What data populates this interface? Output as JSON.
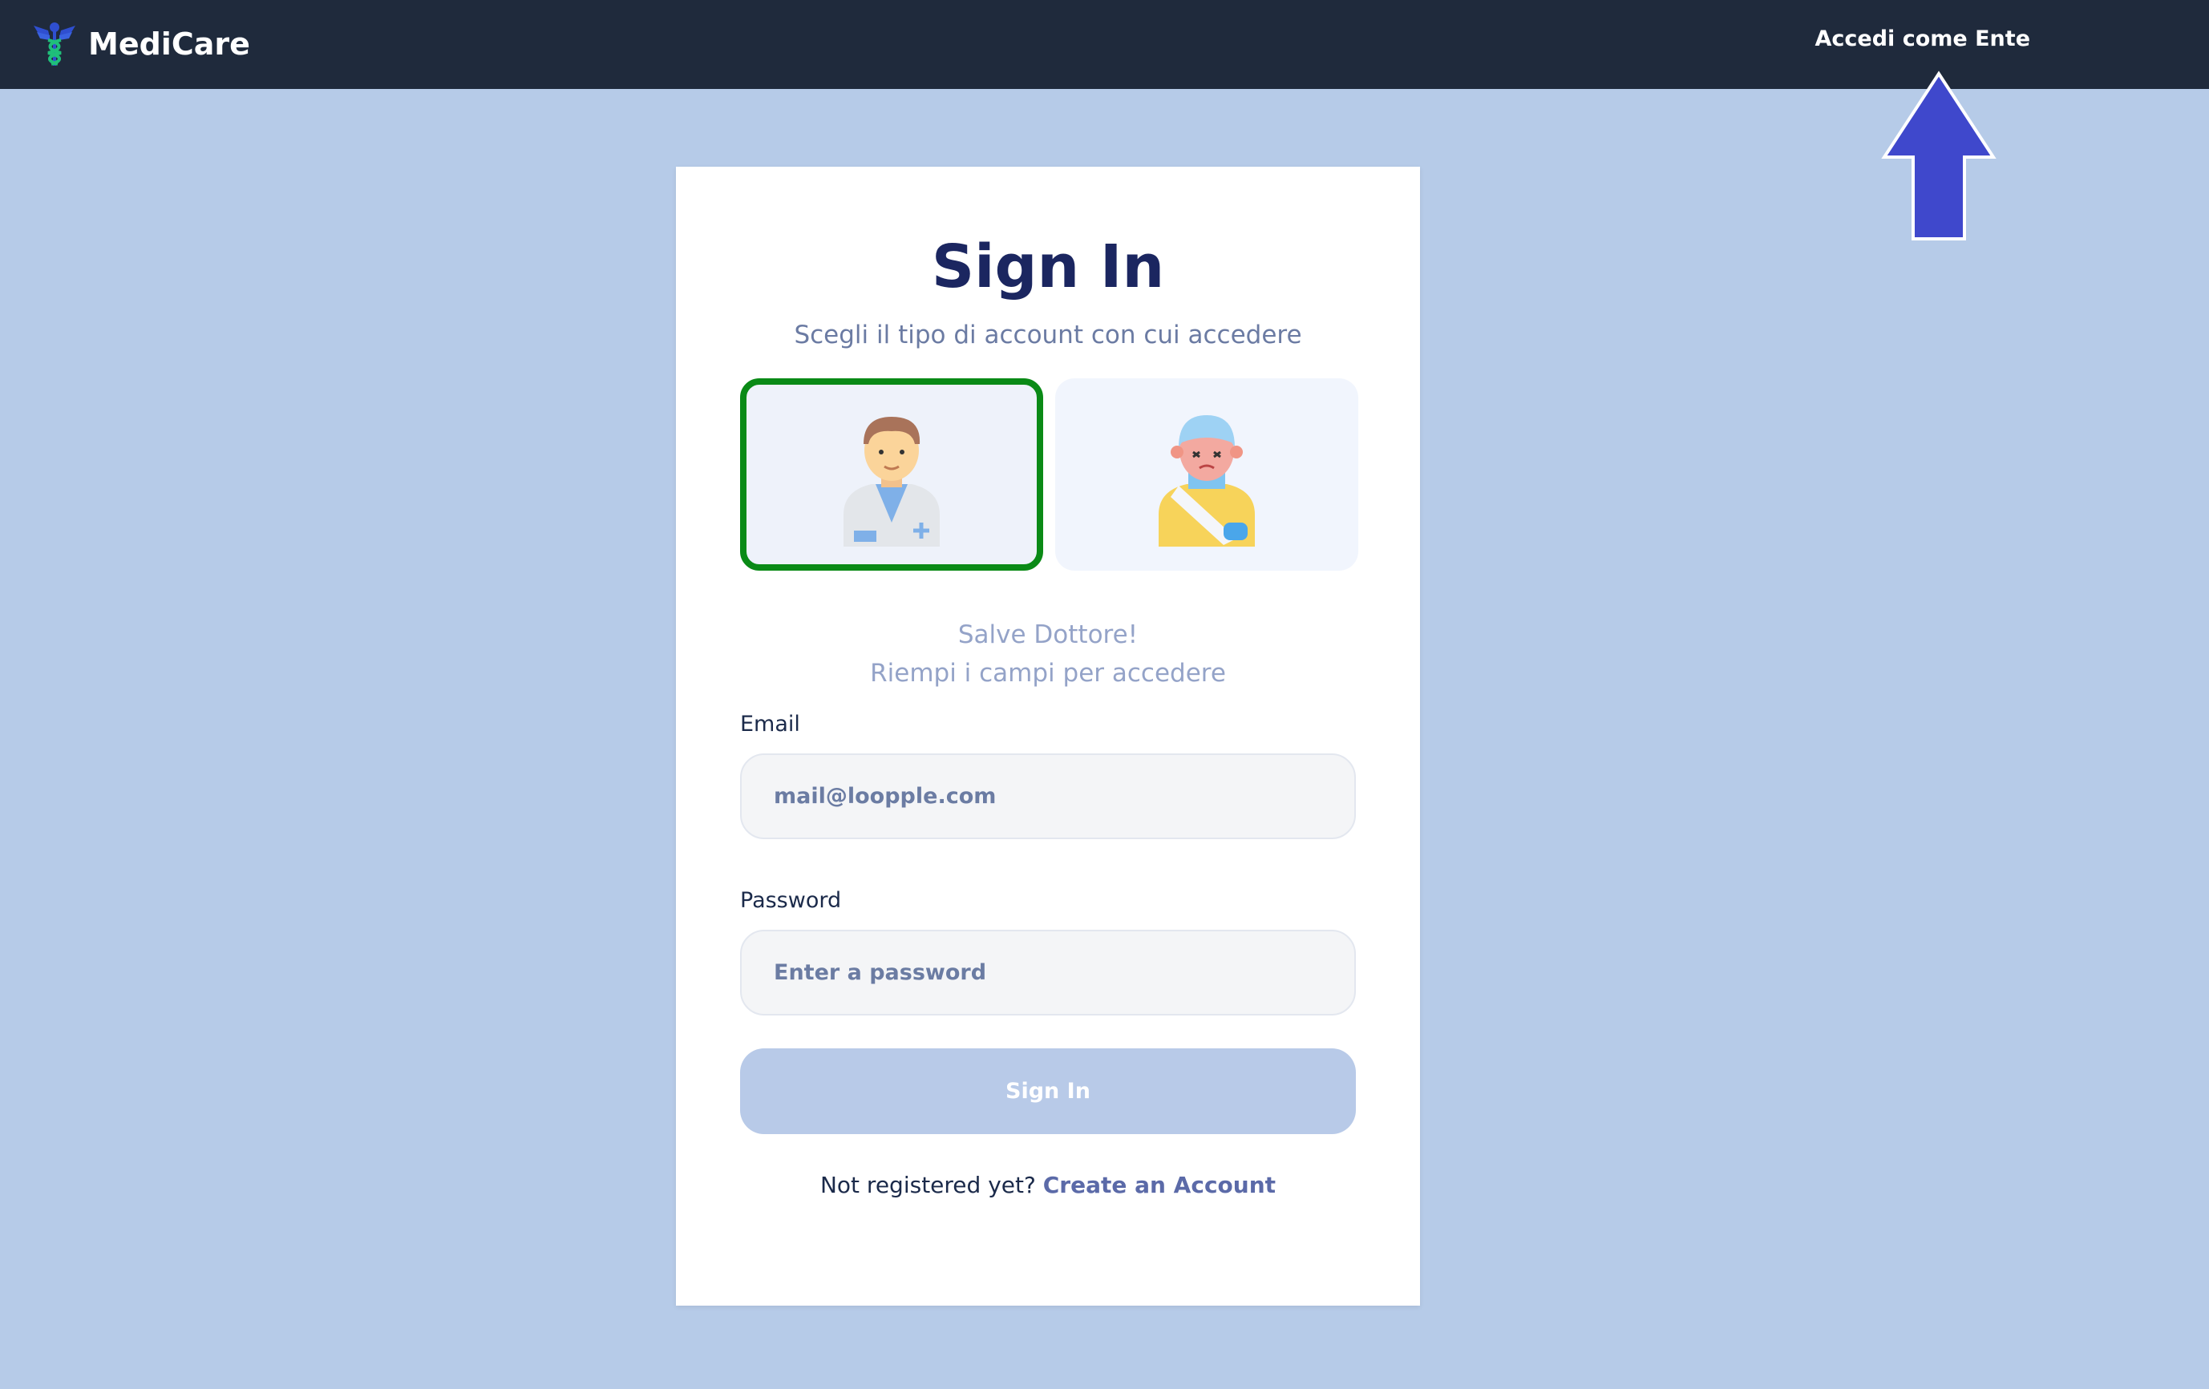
{
  "app": {
    "name": "MediCare"
  },
  "nav": {
    "login_as_entity": "Accedi come Ente"
  },
  "card": {
    "title": "Sign In",
    "subtitle": "Scegli il tipo di account con cui accedere",
    "roles": [
      {
        "icon": "doctor-avatar-icon",
        "selected": true
      },
      {
        "icon": "injured-patient-avatar-icon",
        "selected": false
      }
    ],
    "greeting_line1": "Salve Dottore!",
    "greeting_line2": "Riempi i campi per accedere",
    "email_label": "Email",
    "email_placeholder": "mail@loopple.com",
    "password_label": "Password",
    "password_placeholder": "Enter a password",
    "sign_in_button": "Sign In",
    "register_prompt": "Not registered yet?",
    "register_link": "Create an Account"
  },
  "colors": {
    "navbar": "#1f2a3c",
    "background": "#b6cbe8",
    "selected_border": "#0a8a16",
    "arrow": "#3f48cc",
    "title": "#1b2660"
  }
}
